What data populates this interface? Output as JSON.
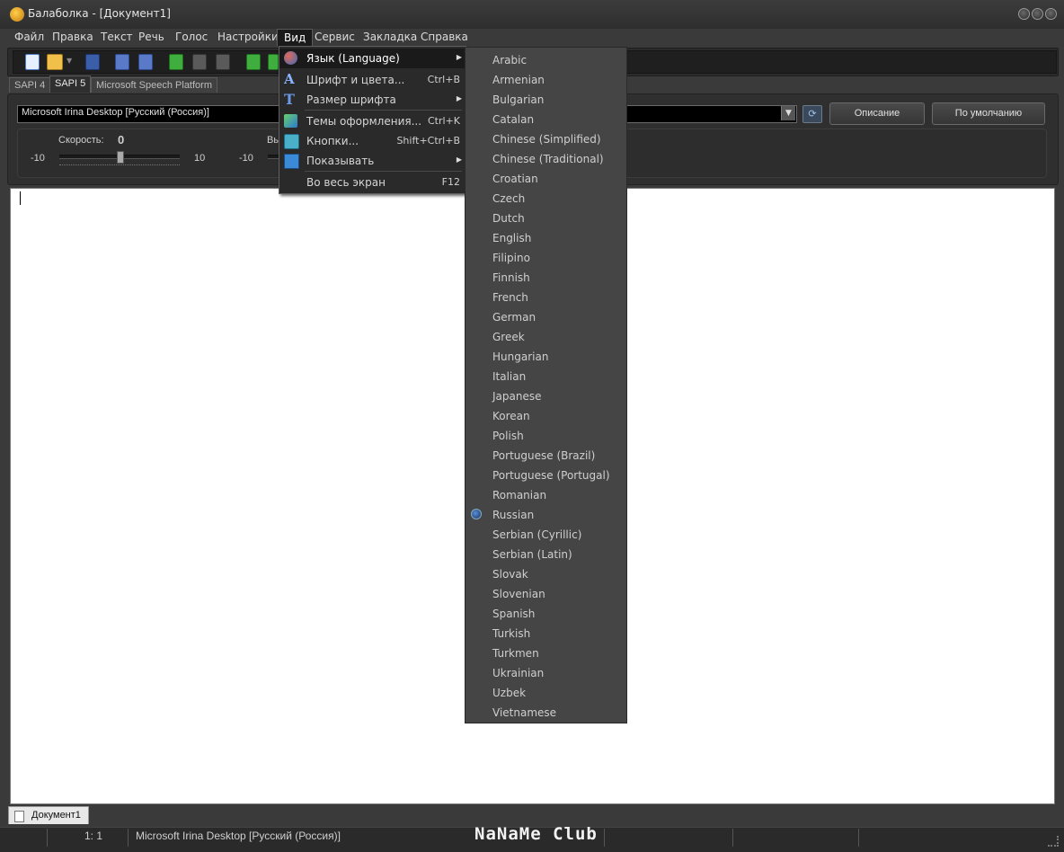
{
  "window": {
    "title": "Балаболка - [Документ1]"
  },
  "menubar": [
    {
      "label": "Файл"
    },
    {
      "label": "Правка"
    },
    {
      "label": "Текст"
    },
    {
      "label": "Речь"
    },
    {
      "label": "Голос"
    },
    {
      "label": "Настройки"
    },
    {
      "label": "Вид"
    },
    {
      "label": "Сервис"
    },
    {
      "label": "Закладка"
    },
    {
      "label": "Справка"
    }
  ],
  "engine_tabs": [
    "SAPI 4",
    "SAPI 5",
    "Microsoft Speech Platform"
  ],
  "voice": {
    "selected": "Microsoft Irina Desktop [Русский (Россия)]",
    "description_button": "Описание",
    "default_button": "По умолчанию"
  },
  "sliders": {
    "speed_label": "Скорость:",
    "speed_value": "0",
    "speed_min": "-10",
    "speed_max": "10",
    "second_min": "-10",
    "second_label_fragment": "Вы"
  },
  "view_menu": [
    {
      "label": "Язык (Language)",
      "shortcut": "",
      "submenu": true,
      "icon": "language-icon"
    },
    {
      "label": "Шрифт и цвета...",
      "shortcut": "Ctrl+B",
      "submenu": false,
      "icon": "font-icon"
    },
    {
      "label": "Размер шрифта",
      "shortcut": "",
      "submenu": true,
      "icon": "font-size-icon"
    },
    {
      "label": "Темы оформления...",
      "shortcut": "Ctrl+K",
      "submenu": false,
      "icon": "themes-icon"
    },
    {
      "label": "Кнопки...",
      "shortcut": "Shift+Ctrl+B",
      "submenu": false,
      "icon": "buttons-icon"
    },
    {
      "label": "Показывать",
      "shortcut": "",
      "submenu": true,
      "icon": "show-icon"
    },
    {
      "label": "Во весь экран",
      "shortcut": "F12",
      "submenu": false,
      "icon": ""
    }
  ],
  "languages": [
    "Arabic",
    "Armenian",
    "Bulgarian",
    "Catalan",
    "Chinese (Simplified)",
    "Chinese (Traditional)",
    "Croatian",
    "Czech",
    "Dutch",
    "English",
    "Filipino",
    "Finnish",
    "French",
    "German",
    "Greek",
    "Hungarian",
    "Italian",
    "Japanese",
    "Korean",
    "Polish",
    "Portuguese (Brazil)",
    "Portuguese (Portugal)",
    "Romanian",
    "Russian",
    "Serbian (Cyrillic)",
    "Serbian (Latin)",
    "Slovak",
    "Slovenian",
    "Spanish",
    "Turkish",
    "Turkmen",
    "Ukrainian",
    "Uzbek",
    "Vietnamese"
  ],
  "selected_language": "Russian",
  "document_tab": "Документ1",
  "status": {
    "position": "1:   1",
    "voice": "Microsoft Irina Desktop [Русский (Россия)]"
  },
  "watermark": "NaNaMe Club",
  "colors": {
    "background": "#3a3a3a",
    "editor": "#ffffff",
    "menu_highlight": "#1a1a1a",
    "submenu_bg": "#454545"
  }
}
